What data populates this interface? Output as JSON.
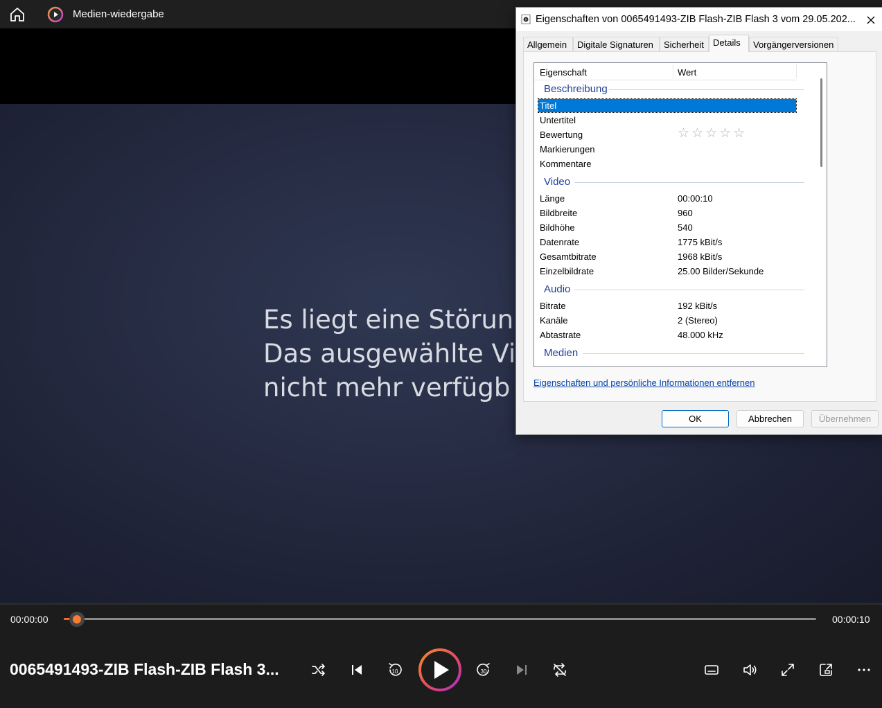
{
  "app": {
    "title": "Medien-wiedergabe"
  },
  "video": {
    "message_lines": [
      "Es liegt eine Störun",
      "Das ausgewählte Vi",
      "nicht mehr verfügb"
    ]
  },
  "player": {
    "time_current": "00:00:00",
    "time_total": "00:00:10",
    "progress": 0.01,
    "media_title": "0065491493-ZIB Flash-ZIB Flash 3...",
    "accent_color": "#f36b2a"
  },
  "dialog": {
    "title": "Eigenschaften von 0065491493-ZIB Flash-ZIB Flash 3 vom 29.05.202...",
    "tabs": [
      "Allgemein",
      "Digitale Signaturen",
      "Sicherheit",
      "Details",
      "Vorgängerversionen"
    ],
    "active_tab": "Details",
    "columns": {
      "property": "Eigenschaft",
      "value": "Wert"
    },
    "groups": {
      "beschreibung": "Beschreibung",
      "video": "Video",
      "audio": "Audio",
      "medien": "Medien"
    },
    "beschreibung_rows": [
      {
        "key": "Titel",
        "value": ""
      },
      {
        "key": "Untertitel",
        "value": ""
      },
      {
        "key": "Bewertung",
        "value": ""
      },
      {
        "key": "Markierungen",
        "value": ""
      },
      {
        "key": "Kommentare",
        "value": ""
      }
    ],
    "rating_stars": "☆☆☆☆☆",
    "video_rows": [
      {
        "key": "Länge",
        "value": "00:00:10"
      },
      {
        "key": "Bildbreite",
        "value": "960"
      },
      {
        "key": "Bildhöhe",
        "value": "540"
      },
      {
        "key": "Datenrate",
        "value": "1775 kBit/s"
      },
      {
        "key": "Gesamtbitrate",
        "value": "1968 kBit/s"
      },
      {
        "key": "Einzelbildrate",
        "value": "25.00 Bilder/Sekunde"
      }
    ],
    "audio_rows": [
      {
        "key": "Bitrate",
        "value": "192 kBit/s"
      },
      {
        "key": "Kanäle",
        "value": "2 (Stereo)"
      },
      {
        "key": "Abtastrate",
        "value": "48.000 kHz"
      }
    ],
    "remove_link": "Eigenschaften und persönliche Informationen entfernen",
    "buttons": {
      "ok": "OK",
      "cancel": "Abbrechen",
      "apply": "Übernehmen"
    }
  }
}
